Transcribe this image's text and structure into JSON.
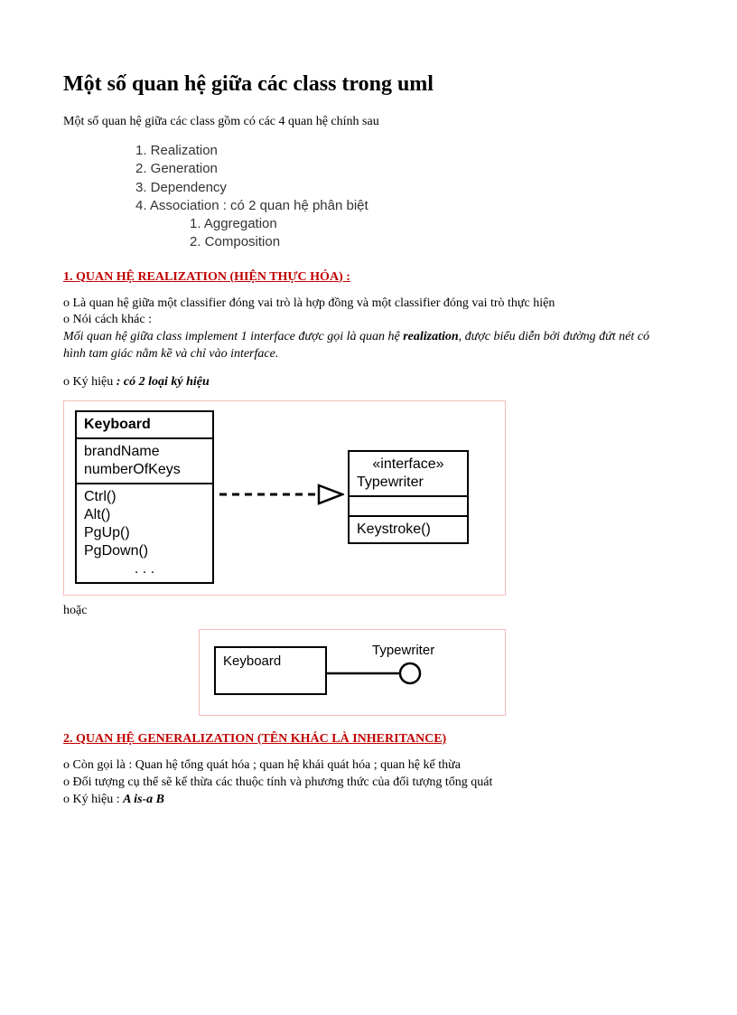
{
  "title": "Một số quan hệ giữa các class trong uml",
  "intro": "Một số quan hệ giữa các class gồm có các 4 quan hệ chính sau",
  "list": {
    "i1": "1.  Realization",
    "i2": "2.  Generation",
    "i3": "3.  Dependency",
    "i4": "4.  Association : có 2 quan hệ phân biệt",
    "s1": "1.  Aggregation",
    "s2": "2.  Composition"
  },
  "sec1": {
    "heading": "1. QUAN HỆ REALIZATION  (HIỆN THỰC HÓA) :",
    "p1": "o Là quan hệ giữa một classifier  đóng vai trò là hợp đồng và một classifier  đóng vai trò thực hiện",
    "p2": "o Nói cách khác :",
    "p3a": "Mối quan hệ giữa class implement 1 interface được gọi là quan hệ ",
    "realization_word": "realization",
    "p3b": ", được biểu diễn bởi đường đứt nét có hình tam giác nằm kề và chỉ vào interface.",
    "p4a": "o Ký hiệu ",
    "p4b": ": có 2 loại ký hiệu",
    "hoac": "hoặc"
  },
  "fig1": {
    "class_name": "Keyboard",
    "attr1": "brandName",
    "attr2": "numberOfKeys",
    "op1": "Ctrl()",
    "op2": "Alt()",
    "op3": "PgUp()",
    "op4": "PgDown()",
    "op5": ". . .",
    "iface_stereo": "«interface»",
    "iface_name": "Typewriter",
    "iface_op": "Keystroke()"
  },
  "fig2": {
    "class_name": "Keyboard",
    "iface_name": "Typewriter"
  },
  "sec2": {
    "heading": "2. QUAN HỆ GENERALIZATION  (TÊN KHÁC LÀ INHERITANCE) ",
    "p1": "o Còn gọi là : Quan hệ tổng quát hóa ; quan hệ khái quát hóa ; quan hệ kế thừa",
    "p2": "o Đối tượng cụ thể sẽ kế thừa các thuộc tính và phương thức của đối tượng tổng quát",
    "p3a": "o Ký hiệu : ",
    "p3b": "A is-a B"
  }
}
